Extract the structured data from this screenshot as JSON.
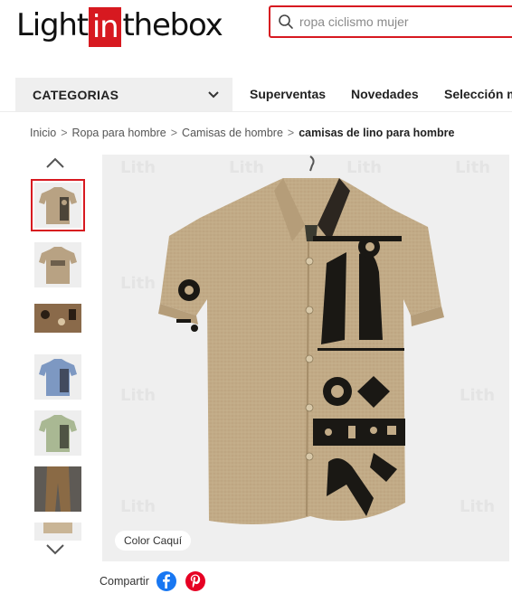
{
  "header": {
    "logo": {
      "left": "Light",
      "in": "in",
      "right": "thebox"
    },
    "search": {
      "placeholder": "ropa ciclismo mujer",
      "icon": "search-icon"
    }
  },
  "nav": {
    "categories_label": "CATEGORIAS",
    "links": [
      "Superventas",
      "Novedades",
      "Selección m"
    ]
  },
  "breadcrumb": {
    "items": [
      "Inicio",
      "Ropa para hombre",
      "Camisas de hombre"
    ],
    "separator": ">",
    "current": "camisas de lino para hombre"
  },
  "gallery": {
    "thumbnails": [
      {
        "name": "khaki-front",
        "color": "#b8a283",
        "active": true
      },
      {
        "name": "khaki-back",
        "color": "#b8a283",
        "active": false
      },
      {
        "name": "fabric-detail",
        "color": "#7a5a3f",
        "active": false
      },
      {
        "name": "blue",
        "color": "#7d98c2",
        "active": false
      },
      {
        "name": "green",
        "color": "#a9b893",
        "active": false
      },
      {
        "name": "model-pants",
        "color": "#8a6a45",
        "active": false
      },
      {
        "name": "partial",
        "color": "#c9b596",
        "active": false
      }
    ],
    "color_label": "Color Caquí",
    "watermark": "Lith"
  },
  "share": {
    "label": "Compartir",
    "icons": [
      "facebook-icon",
      "pinterest-icon"
    ]
  },
  "colors": {
    "brand_red": "#d71920",
    "shirt_khaki": "#c2ab87",
    "print_black": "#1a1814",
    "facebook": "#1877f2",
    "pinterest": "#e60023"
  }
}
